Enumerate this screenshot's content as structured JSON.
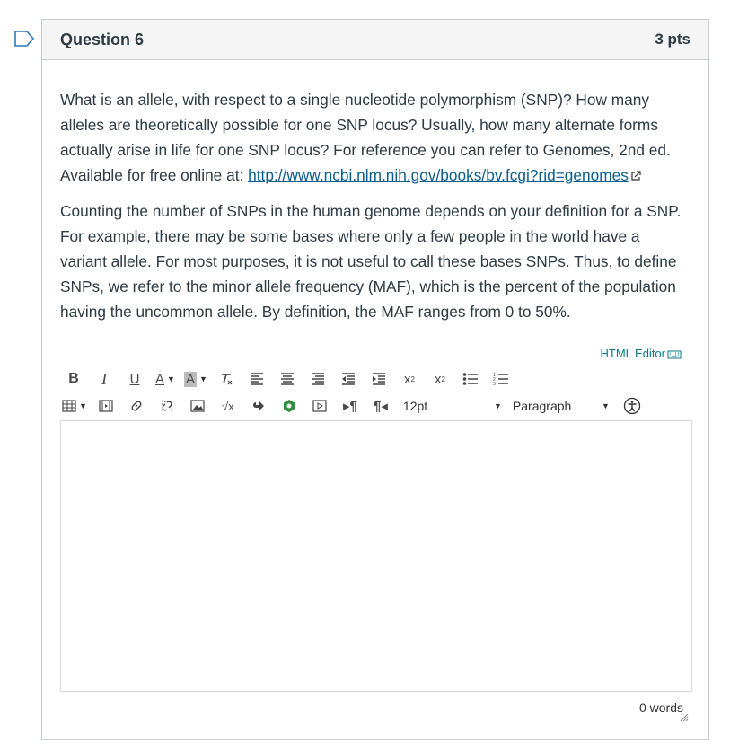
{
  "question": {
    "title": "Question 6",
    "points": "3 pts",
    "para1": "What is an allele, with respect to a single nucleotide polymorphism (SNP)? How many alleles are theoretically possible for one SNP locus? Usually, how many alternate forms actually arise in life for one SNP locus? For reference you can refer to Genomes, 2nd ed. Available for free online at: ",
    "link_text": "http://www.ncbi.nlm.nih.gov/books/bv.fcgi?rid=genomes",
    "para2": "Counting the number of SNPs in the human genome depends on your definition for a SNP. For example, there may be some bases where only a few people in the world have a variant allele. For most purposes, it is not useful to call these bases SNPs. Thus, to define SNPs, we refer to the minor allele frequency (MAF), which is the percent of the population having the uncommon allele. By definition, the MAF ranges from 0 to 50%."
  },
  "editor": {
    "html_editor_label": "HTML Editor",
    "toolbar_row1": [
      "bold",
      "italic",
      "underline",
      "text-color",
      "background-color",
      "clear-formatting",
      "align-left",
      "align-center",
      "align-right",
      "outdent",
      "indent",
      "superscript",
      "subscript",
      "bullet-list",
      "numbered-list"
    ],
    "toolbar_row2": [
      "table",
      "media",
      "link",
      "unlink",
      "image",
      "math",
      "embed",
      "apps",
      "video",
      "ltr",
      "rtl"
    ],
    "font_size": "12pt",
    "block_format": "Paragraph",
    "word_count": "0 words"
  },
  "colors": {
    "link": "#0b5f8e",
    "accent": "#0b7a8a",
    "border": "#c7cdd1"
  }
}
